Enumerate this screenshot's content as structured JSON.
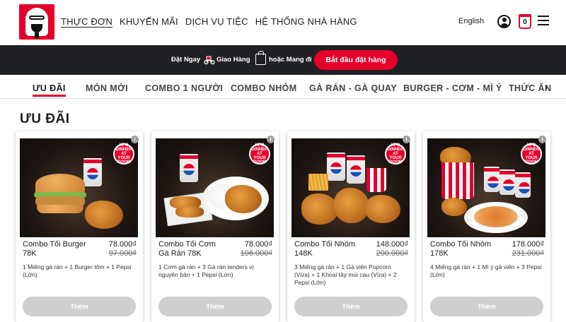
{
  "header": {
    "nav": [
      "THỰC ĐƠN",
      "KHUYẾN MÃI",
      "DỊCH VỤ TIỆC",
      "HỆ THỐNG NHÀ HÀNG"
    ],
    "language": "English",
    "cart_count": "0"
  },
  "orderbar": {
    "order_now": "Đặt Ngay",
    "delivery": "Giao Hàng",
    "pickup": "hoặc Mang đi",
    "start_button": "Bắt đầu đặt hàng"
  },
  "categories": [
    "ƯU ĐÃI",
    "MÓN MỚI",
    "COMBO 1 NGƯỜI",
    "COMBO NHÓM",
    "GÀ RÁN - GÀ QUAY",
    "BURGER - CƠM - MÌ Ý",
    "THỨC ĂN"
  ],
  "section": {
    "title": "ƯU ĐÃI"
  },
  "cards": [
    {
      "name": "Combo Tối Burger 78K",
      "price": "78.000₫",
      "old_price": "97.000₫",
      "desc": "1 Miếng gà rán + 1 Burger tôm + 1 Pepsi (Lớn)",
      "button": "Thêm",
      "badge": "KFC DINNER AT YOUR DOOR"
    },
    {
      "name": "Combo Tối Cơm Gà Rán 78K",
      "price": "78.000₫",
      "old_price": "106.000₫",
      "desc": "1 Cơm gà rán + 3 Gà rán tenders vị nguyên bản + 1 Pepsi (Lớn)",
      "button": "Thêm",
      "badge": "KFC DINNER AT YOUR DOOR"
    },
    {
      "name": "Combo Tối Nhóm 148K",
      "price": "148.000₫",
      "old_price": "200.000₫",
      "desc": "3 Miếng gà rán + 1 Gà viên Popcorn (Vừa) + 1 Khoai tây múi cau (Vừa) + 2 Pepsi (Lớn)",
      "button": "Thêm",
      "badge": "KFC DINNER AT YOUR DOOR"
    },
    {
      "name": "Combo Tối Nhóm 178K",
      "price": "178.000₫",
      "old_price": "231.000₫",
      "desc": "4 Miếng gà rán + 1 Mì ý gà viên + 3 Pepsi (Lớn)",
      "button": "Thêm",
      "badge": "KFC DINNER AT YOUR DOOR"
    }
  ],
  "colors": {
    "brand": "#e4002b",
    "dark": "#202124",
    "disabled_button": "#cfcfcf"
  }
}
